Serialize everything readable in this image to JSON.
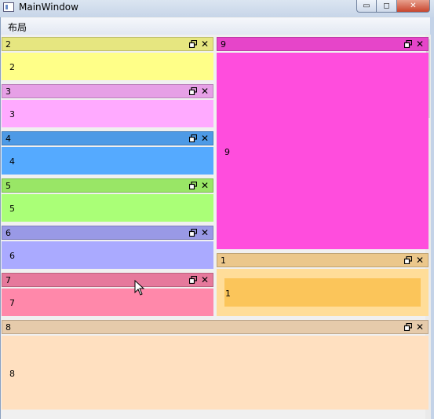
{
  "window": {
    "title": "MainWindow",
    "min_label": "▭",
    "max_label": "◻",
    "close_label": "✕"
  },
  "menu": {
    "items": [
      {
        "label": "布局"
      }
    ]
  },
  "panels": {
    "p2": {
      "title": "2",
      "content": "2",
      "header_color": "#e6e680",
      "body_color": "#ffff88"
    },
    "p3": {
      "title": "3",
      "content": "3",
      "header_color": "#e6a0e6",
      "body_color": "#ffaaff"
    },
    "p4": {
      "title": "4",
      "content": "4",
      "header_color": "#4d9ae6",
      "body_color": "#55aaff"
    },
    "p5": {
      "title": "5",
      "content": "5",
      "header_color": "#99e666",
      "body_color": "#aaff77"
    },
    "p6": {
      "title": "6",
      "content": "6",
      "header_color": "#9999e6",
      "body_color": "#aaaaff"
    },
    "p7": {
      "title": "7",
      "content": "7",
      "header_color": "#e6799c",
      "body_color": "#ff88aa"
    },
    "p9": {
      "title": "9",
      "content": "9",
      "header_color": "#e645c9",
      "body_color": "#ff4ddd"
    },
    "p1": {
      "title": "1",
      "content": "1",
      "header_color": "#ebc78b",
      "body_color": "#ffdd99",
      "inner_color": "#fbc55a"
    },
    "p8": {
      "title": "8",
      "content": "8",
      "header_color": "#e6cbab",
      "body_color": "#ffe0c0"
    }
  },
  "icons": {
    "float": "restore-window-icon",
    "close": "close-icon",
    "cursor": "mouse-pointer-icon"
  }
}
